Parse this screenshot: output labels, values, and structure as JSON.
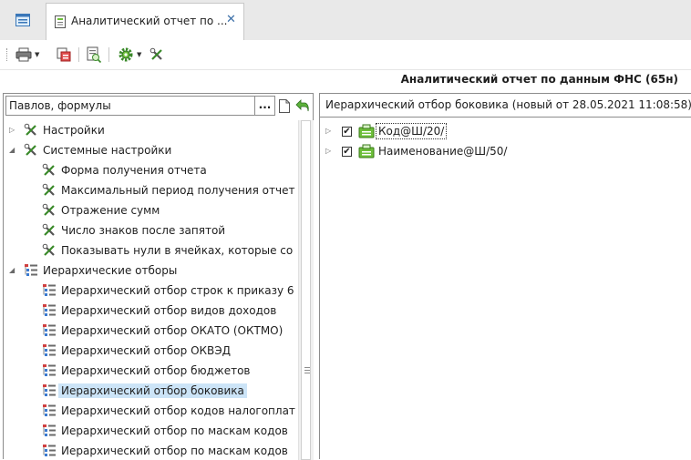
{
  "tabs": {
    "home_icon": "window-icon",
    "active_tab": {
      "label": "Аналитический отчет по ...",
      "icon": "report-doc-icon",
      "close": "✕"
    }
  },
  "toolbar": {
    "buttons": [
      "print-icon",
      "export-icon",
      "preview-icon",
      "gear-icon",
      "tools-icon"
    ]
  },
  "report_title": "Аналитический отчет по данным ФНС (65н)",
  "left": {
    "reference_value": "Павлов, формулы",
    "more_button": "...",
    "tree": [
      {
        "label": "Настройки",
        "icon": "tools-icon",
        "expander": "▷"
      },
      {
        "label": "Системные настройки",
        "icon": "tools-icon",
        "expander": "◢"
      },
      {
        "label": "Форма получения отчета",
        "icon": "tools-icon"
      },
      {
        "label": "Максимальный период получения отчет",
        "icon": "tools-icon"
      },
      {
        "label": "Отражение сумм",
        "icon": "tools-icon"
      },
      {
        "label": "Число знаков после запятой",
        "icon": "tools-icon"
      },
      {
        "label": "Показывать нули в ячейках, которые со",
        "icon": "tools-icon"
      },
      {
        "label": "Иерархические отборы",
        "icon": "hierarchy-icon",
        "expander": "◢"
      },
      {
        "label": "Иерархический отбор строк к приказу 6",
        "icon": "hierarchy-icon"
      },
      {
        "label": "Иерархический отбор видов доходов",
        "icon": "hierarchy-icon"
      },
      {
        "label": "Иерархический отбор ОКАТО (ОКТМО)",
        "icon": "hierarchy-icon"
      },
      {
        "label": "Иерархический отбор ОКВЭД",
        "icon": "hierarchy-icon"
      },
      {
        "label": "Иерархический отбор бюджетов",
        "icon": "hierarchy-icon"
      },
      {
        "label": "Иерархический отбор боковика",
        "icon": "hierarchy-icon",
        "selected": true
      },
      {
        "label": "Иерархический отбор кодов налогоплат",
        "icon": "hierarchy-icon"
      },
      {
        "label": "Иерархический отбор по маскам кодов",
        "icon": "hierarchy-icon"
      },
      {
        "label": "Иерархический отбор по маскам кодов",
        "icon": "hierarchy-icon"
      }
    ]
  },
  "right": {
    "header": "Иерархический отбор боковика (новый от 28.05.2021 11:08:58)",
    "items": [
      {
        "label": "Код@Ш/20/",
        "checked": true,
        "expander": "▷",
        "icon": "folder-group-icon",
        "focused": true
      },
      {
        "label": "Наименование@Ш/50/",
        "checked": true,
        "expander": "▷",
        "icon": "folder-group-icon"
      }
    ]
  },
  "colors": {
    "selection": "#cce4f7",
    "tab_strip": "#e9e9e9",
    "group_icon": "#6dbf3a",
    "close_accent": "#3c6fa8"
  }
}
